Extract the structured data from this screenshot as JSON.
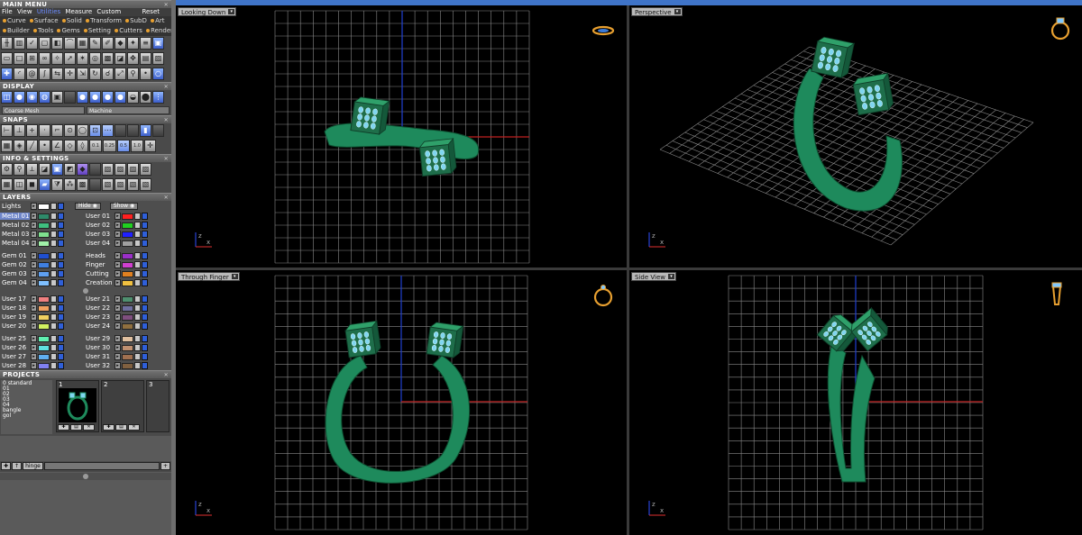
{
  "main_menu": {
    "title": "MAIN MENU",
    "menubar": [
      "File",
      "View",
      "Utilities",
      "Measure",
      "Custom"
    ],
    "reset_label": "Reset",
    "row1": [
      "Curve",
      "Surface",
      "Solid",
      "Transform",
      "SubD",
      "Art"
    ],
    "row2": [
      "Builder",
      "Tools",
      "Gems",
      "Setting",
      "Cutters",
      "Render"
    ]
  },
  "display": {
    "title": "DISPLAY",
    "mesh_option": "Coarse Mesh",
    "machine_option": "Machine"
  },
  "snaps": {
    "title": "SNAPS",
    "values": [
      "0.1",
      "0.25",
      "0.5",
      "1.0"
    ]
  },
  "info": {
    "title": "INFO & SETTINGS"
  },
  "layers": {
    "title": "LAYERS",
    "lights_label": "Lights",
    "hide_label": "Hide",
    "show_label": "Show",
    "groups": [
      {
        "left": [
          {
            "name": "Metal 01",
            "color": "#2e8a6a",
            "selected": true
          },
          {
            "name": "Metal 02",
            "color": "#3fbf7f"
          },
          {
            "name": "Metal 03",
            "color": "#7fe08f"
          },
          {
            "name": "Metal 04",
            "color": "#a0f0a8"
          }
        ],
        "right": [
          {
            "name": "User 01",
            "color": "#ff2020"
          },
          {
            "name": "User 02",
            "color": "#20d020"
          },
          {
            "name": "User 03",
            "color": "#2020ff"
          },
          {
            "name": "User 04",
            "color": "#a0a0a0"
          }
        ]
      },
      {
        "left": [
          {
            "name": "Gem 01",
            "color": "#1f4fd0"
          },
          {
            "name": "Gem 02",
            "color": "#3f7fe0"
          },
          {
            "name": "Gem 03",
            "color": "#5fa0f0"
          },
          {
            "name": "Gem 04",
            "color": "#7fc0ff"
          }
        ],
        "right": [
          {
            "name": "Heads",
            "color": "#9a2fc8"
          },
          {
            "name": "Finger",
            "color": "#d040d0"
          },
          {
            "name": "Cutting",
            "color": "#e08020"
          },
          {
            "name": "Creation",
            "color": "#f0c040"
          }
        ]
      },
      {
        "left": [
          {
            "name": "User 17",
            "color": "#f08080"
          },
          {
            "name": "User 18",
            "color": "#f0a060"
          },
          {
            "name": "User 19",
            "color": "#f0d060"
          },
          {
            "name": "User 20",
            "color": "#d0f060"
          }
        ],
        "right": [
          {
            "name": "User 21",
            "color": "#4f8f6f"
          },
          {
            "name": "User 22",
            "color": "#6f6f9f"
          },
          {
            "name": "User 23",
            "color": "#7f4f7f"
          },
          {
            "name": "User 24",
            "color": "#8f6f3f"
          }
        ]
      },
      {
        "left": [
          {
            "name": "User 25",
            "color": "#60f0b0"
          },
          {
            "name": "User 26",
            "color": "#60e0e0"
          },
          {
            "name": "User 27",
            "color": "#60b0f0"
          },
          {
            "name": "User 28",
            "color": "#8080f0"
          }
        ],
        "right": [
          {
            "name": "User 29",
            "color": "#e0c0a0"
          },
          {
            "name": "User 30",
            "color": "#c09070"
          },
          {
            "name": "User 31",
            "color": "#a07050"
          },
          {
            "name": "User 32",
            "color": "#806040"
          }
        ]
      }
    ]
  },
  "projects": {
    "title": "PROJECTS",
    "items": [
      "0 standard",
      "01",
      "02",
      "03",
      "04",
      "bangle",
      "gol"
    ],
    "slots": [
      "1",
      "2",
      "3"
    ],
    "hinge_label": "hinge"
  },
  "viewports": [
    {
      "label": "Looking Down"
    },
    {
      "label": "Perspective"
    },
    {
      "label": "Through Finger"
    },
    {
      "label": "Side View"
    }
  ],
  "colors": {
    "metal": "#1e8a5c",
    "gem": "#7fd6f0",
    "grid": "#8a8a8a",
    "axis_red": "#c02020",
    "axis_blue": "#2040d0",
    "accent": "#e8a030"
  }
}
